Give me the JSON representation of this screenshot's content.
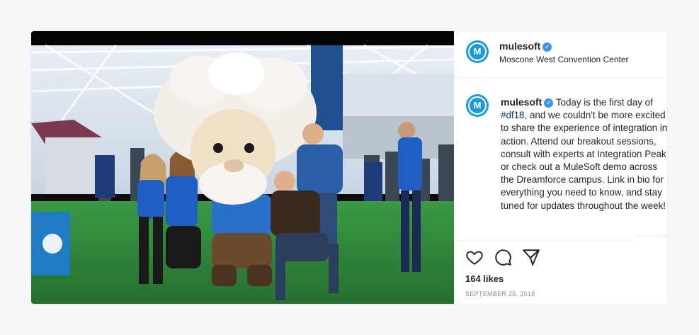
{
  "post": {
    "username": "mulesoft",
    "location": "Moscone West Convention Center",
    "caption_before": " Today is the first day of ",
    "hashtag": "#df18",
    "caption_after": ", and we couldn't be more excited to share the experience of integration in action. Attend our breakout sessions, consult with experts at Integration Peak, or check out a MuleSoft demo across the Dreamforce campus. Link in bio for everything you need to know, and stay tuned for updates throughout the week!",
    "likes": "164 likes",
    "date": "SEPTEMBER 25, 2018",
    "avatar_letter": "M"
  },
  "icons": {
    "verified": "verified-badge-icon",
    "like": "heart-icon",
    "comment": "comment-bubble-icon",
    "share": "paper-plane-icon"
  },
  "colors": {
    "brand": "#1d9bd7",
    "verified": "#3897f0",
    "text": "#262626",
    "muted": "#8e8e8e",
    "hashtag": "#00376b",
    "carpet": "#2f8a3a"
  }
}
